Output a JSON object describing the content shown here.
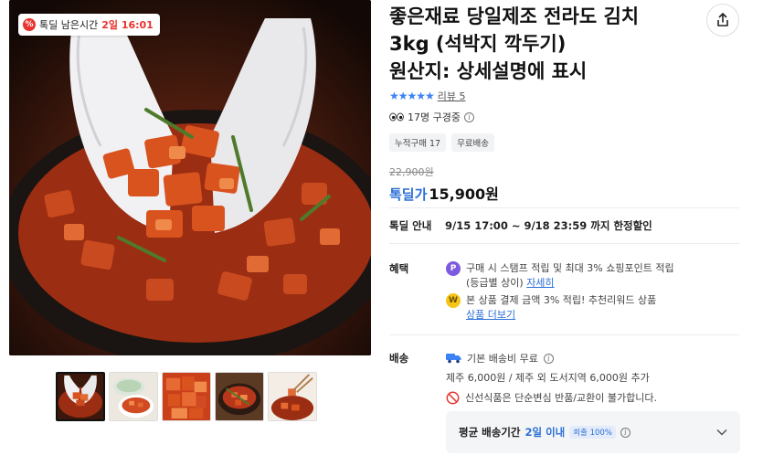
{
  "gallery": {
    "badge": {
      "icon": "percent-icon",
      "label": "톡딜 남은시간",
      "time": "2일 16:01"
    },
    "thumbnails": [
      {
        "name": "thumb-gloves-kimchi",
        "active": true
      },
      {
        "name": "thumb-bowl-kimchi",
        "active": false
      },
      {
        "name": "thumb-red-kimchi",
        "active": false
      },
      {
        "name": "thumb-pot-kimchi",
        "active": false
      },
      {
        "name": "thumb-chopsticks-kimchi",
        "active": false
      }
    ]
  },
  "product": {
    "title_line1": "좋은재료 당일제조 전라도 김치",
    "title_line2": "3kg (석박지 깍두기)",
    "title_line3": "원산지: 상세설명에 표시",
    "rating_stars": "★★★★★",
    "review_link": "리뷰 5",
    "viewers": "17명 구경중",
    "tags": [
      "누적구매 17",
      "무료배송"
    ],
    "original_price": "22,900원",
    "sale_label": "톡딜가",
    "sale_price": "15,900원"
  },
  "deal": {
    "label": "톡딜 안내",
    "period": "9/15 17:00 ~ 9/18 23:59 까지 한정할인"
  },
  "benefits": {
    "label": "혜택",
    "item1_line1": "구매 시 스탬프 적립 및 최대 3% 쇼핑포인트 적립",
    "item1_line2": "(등급별 상이)",
    "item1_link": "자세히",
    "item2_line1": "본 상품 결제 금액 3% 적립! 추천리워드 상품",
    "item2_link": "상품 더보기"
  },
  "shipping": {
    "label": "배송",
    "fee": "기본 배송비 무료",
    "extra": "제주 6,000원 / 제주 외 도서지역 6,000원 추가",
    "notice": "신선식품은 단순변심 반품/교환이 불가합니다.",
    "avg_label": "평균 배송기간",
    "avg_value": "2일 이내",
    "avg_badge": "희출 100%"
  }
}
